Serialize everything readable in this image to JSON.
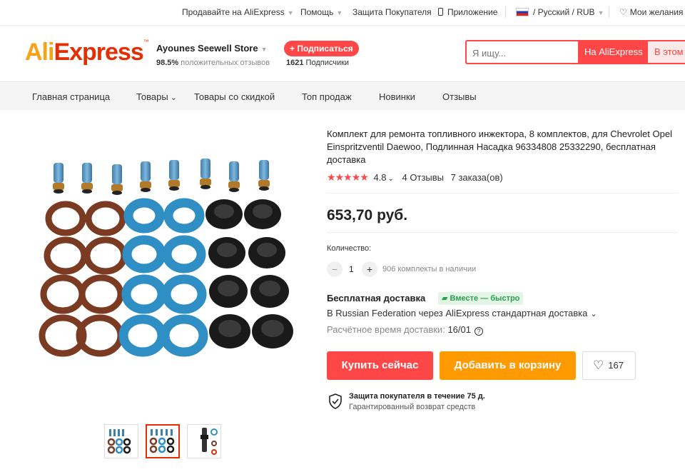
{
  "topbar": {
    "sell": "Продавайте на AliExpress",
    "help": "Помощь",
    "protection": "Защита Покупателя",
    "app": "Приложение",
    "lang": "/ Русский /",
    "currency": "RUB",
    "wishlist": "Мои желания"
  },
  "header": {
    "logo_ali": "Ali",
    "logo_express": "Express",
    "logo_tm": "™",
    "store_name": "Ayounes Seewell Store",
    "positive_pct": "98.5%",
    "positive_label": "положительных отзывов",
    "subscribe_label": "+ Подписаться",
    "subscribers_count": "1621",
    "subscribers_label": "Подписчики",
    "search_placeholder": "Я ищу...",
    "search_btn_all": "На AliExpress",
    "search_btn_store": "В этом"
  },
  "nav": {
    "items": [
      "Главная страница",
      "Товары",
      "Товары со скидкой",
      "Топ продаж",
      "Новинки",
      "Отзывы"
    ]
  },
  "product": {
    "title": "Комплект для ремонта топливного инжектора, 8 комплектов, для Chevrolet Opel Einspritzventil Daewoo, Подлинная Насадка 96334808 25332290, бесплатная доставка",
    "rating": "4.8",
    "stars": 5,
    "reviews": "4 Отзывы",
    "orders": "7 заказа(ов)",
    "price": "653,70 руб.",
    "qty_label": "Количество:",
    "qty_minus": "−",
    "qty_value": "1",
    "qty_plus": "+",
    "stock": "906 комплекты в наличии",
    "shipping_title": "Бесплатная доставка",
    "shipping_badge": "Вместе — быстро",
    "shipping_route": "В Russian Federation через AliExpress стандартная доставка",
    "delivery_label": "Расчётное время доставки:",
    "delivery_date": "16/01",
    "buy_now": "Купить сейчас",
    "add_to_cart": "Добавить в корзину",
    "wish_count": "167",
    "protection_title": "Защита покупателя в течение 75 д.",
    "protection_sub": "Гарантированный возврат средств"
  },
  "colors": {
    "brand_red": "#ff4747",
    "brand_orange": "#ff9a00",
    "oring_brown": "#7a3b22",
    "oring_blue": "#2f8ec4",
    "oring_black": "#1a1a1a"
  }
}
